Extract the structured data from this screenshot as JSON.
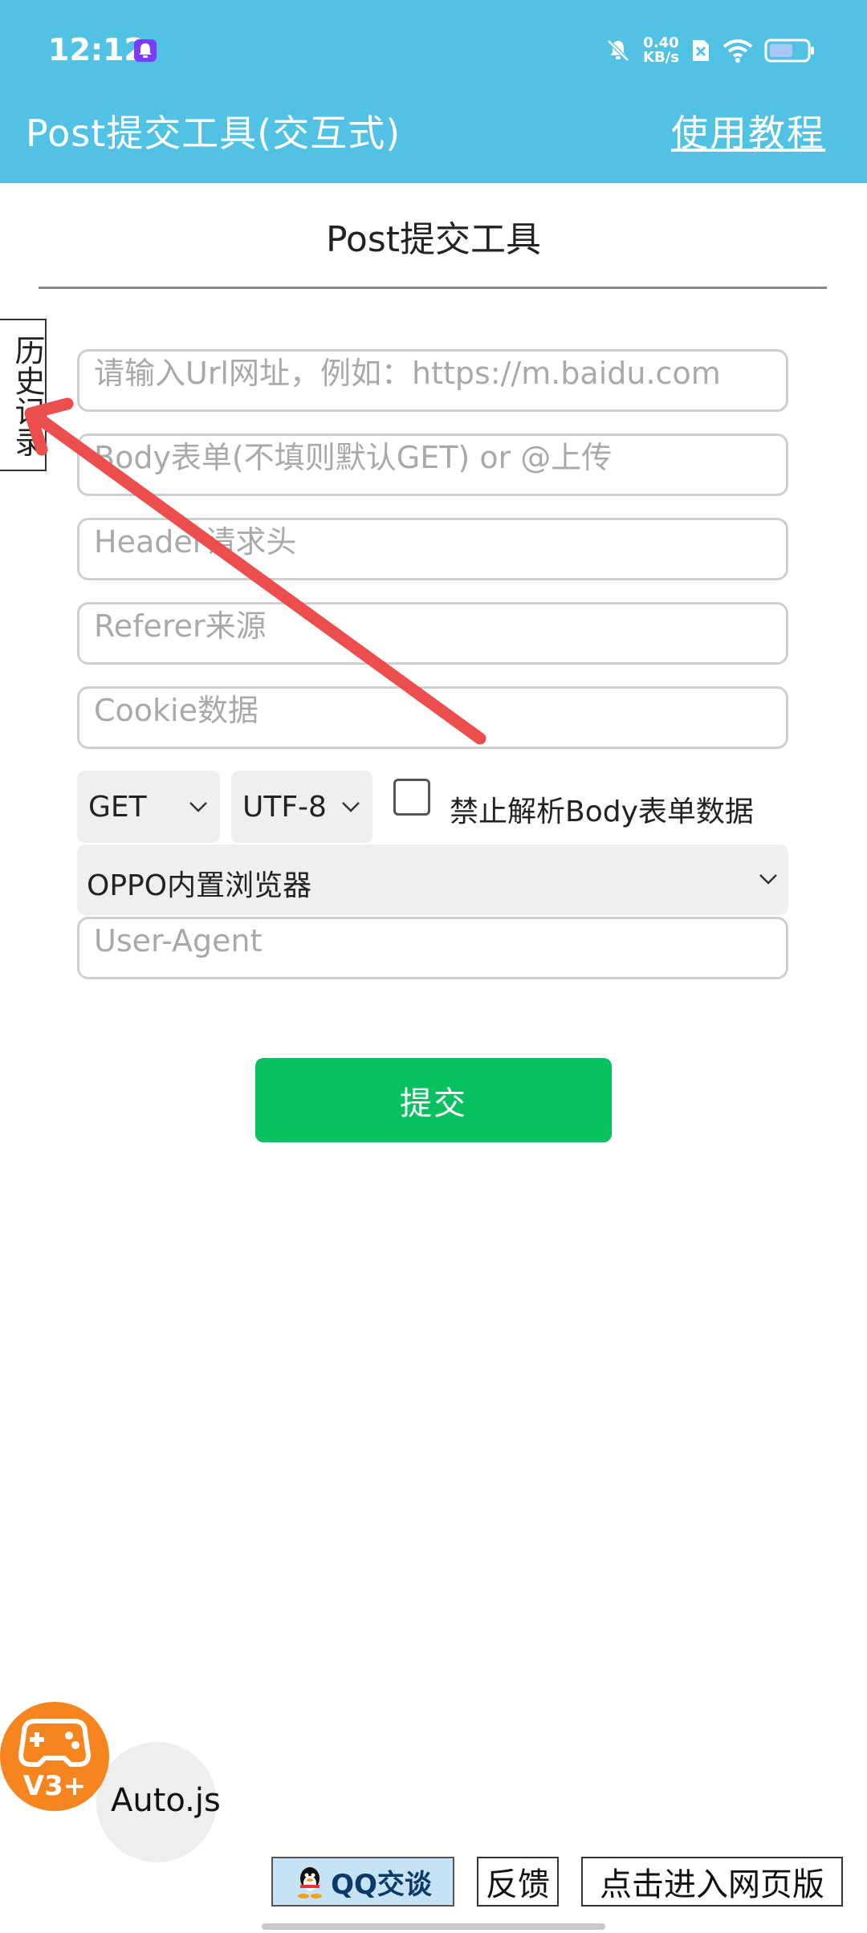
{
  "status_bar": {
    "time": "12:12",
    "net_speed_value": "0.40",
    "net_speed_unit": "KB/s"
  },
  "header": {
    "title": "Post提交工具(交互式)",
    "tutorial_label": "使用教程",
    "color": "#52c2e4"
  },
  "page": {
    "title": "Post提交工具"
  },
  "history_tab": {
    "label": "历史记录"
  },
  "form": {
    "url_placeholder": "请输入Url网址，例如：https://m.baidu.com",
    "body_placeholder": "Body表单(不填则默认GET) or @上传",
    "header_placeholder": "Header请求头",
    "referer_placeholder": "Referer来源",
    "cookie_placeholder": "Cookie数据",
    "method_value": "GET",
    "charset_value": "UTF-8",
    "no_parse_body_label": "禁止解析Body表单数据",
    "no_parse_body_checked": false,
    "ua_preset_value": "OPPO内置浏览器",
    "ua_placeholder": "User-Agent",
    "submit_label": "提交",
    "submit_color": "#07c160"
  },
  "bottom": {
    "badge_text": "V3+",
    "autojs_label": "Auto.js",
    "qq_label": "QQ交谈",
    "feedback_label": "反馈",
    "web_label": "点击进入网页版"
  },
  "annotation": {
    "arrow_color": "#ec4d4d"
  }
}
